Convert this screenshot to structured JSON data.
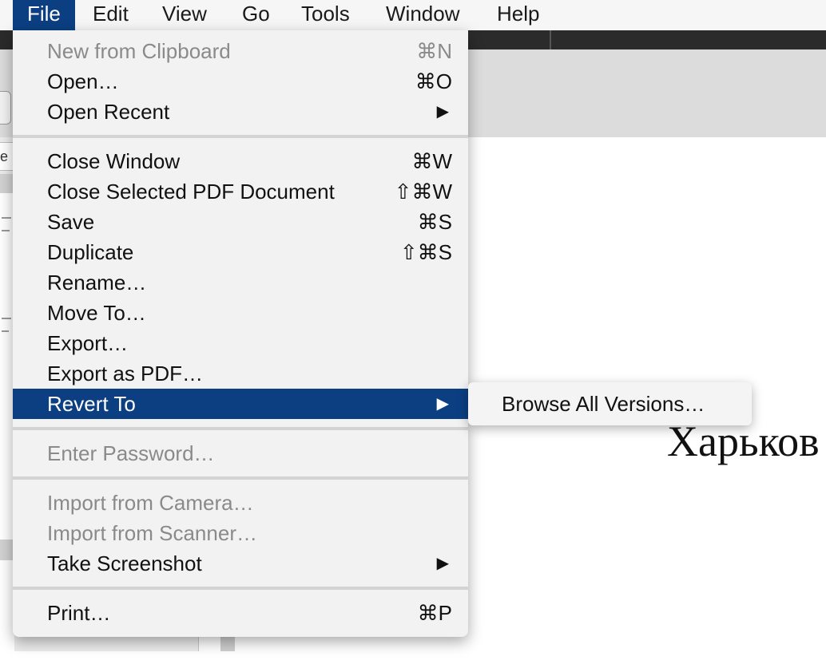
{
  "menubar": {
    "items": [
      "File",
      "Edit",
      "View",
      "Go",
      "Tools",
      "Window",
      "Help"
    ],
    "active": "File"
  },
  "sidebar": {
    "search_fragment": "e"
  },
  "document": {
    "visible_text": "Харьков"
  },
  "file_menu": {
    "new_from_clipboard": {
      "label": "New from Clipboard",
      "shortcut": "⌘N"
    },
    "open": {
      "label": "Open…",
      "shortcut": "⌘O"
    },
    "open_recent": {
      "label": "Open Recent",
      "arrow": "▶"
    },
    "close_window": {
      "label": "Close Window",
      "shortcut": "⌘W"
    },
    "close_selected": {
      "label": "Close Selected PDF Document",
      "shortcut": "⇧⌘W"
    },
    "save": {
      "label": "Save",
      "shortcut": "⌘S"
    },
    "duplicate": {
      "label": "Duplicate",
      "shortcut": "⇧⌘S"
    },
    "rename": {
      "label": "Rename…"
    },
    "move_to": {
      "label": "Move To…"
    },
    "export": {
      "label": "Export…"
    },
    "export_pdf": {
      "label": "Export as PDF…"
    },
    "revert_to": {
      "label": "Revert To",
      "arrow": "▶"
    },
    "enter_password": {
      "label": "Enter Password…"
    },
    "import_camera": {
      "label": "Import from Camera…"
    },
    "import_scanner": {
      "label": "Import from Scanner…"
    },
    "take_screenshot": {
      "label": "Take Screenshot",
      "arrow": "▶"
    },
    "print": {
      "label": "Print…",
      "shortcut": "⌘P"
    }
  },
  "revert_submenu": {
    "browse_all_versions": "Browse All Versions…"
  },
  "colors": {
    "highlight": "#0b3f82",
    "menu_background": "#f2f2f2",
    "disabled_text": "#8a8a8a"
  }
}
